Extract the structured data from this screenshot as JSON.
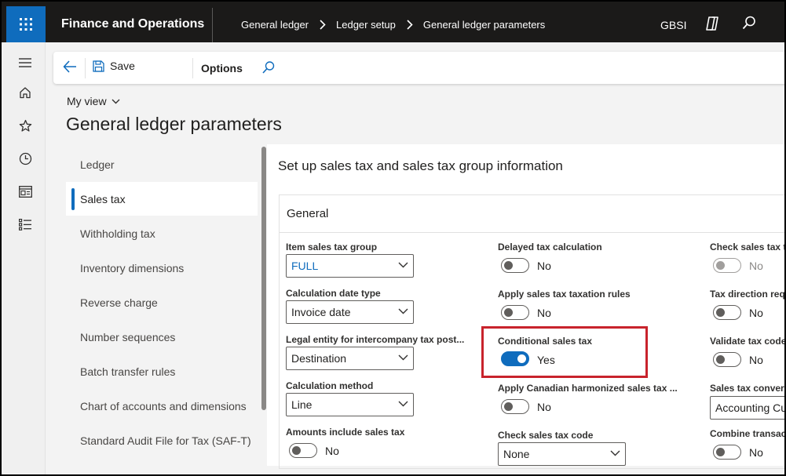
{
  "app": {
    "title": "Finance and Operations",
    "company": "GBSI"
  },
  "breadcrumbs": [
    "General ledger",
    "Ledger setup",
    "General ledger parameters"
  ],
  "action_pane": {
    "save_label": "Save",
    "options_label": "Options"
  },
  "page": {
    "view_label": "My view",
    "title": "General ledger parameters"
  },
  "nav": {
    "items": [
      {
        "label": "Ledger"
      },
      {
        "label": "Sales tax"
      },
      {
        "label": "Withholding tax"
      },
      {
        "label": "Inventory dimensions"
      },
      {
        "label": "Reverse charge"
      },
      {
        "label": "Number sequences"
      },
      {
        "label": "Batch transfer rules"
      },
      {
        "label": "Chart of accounts and dimensions"
      },
      {
        "label": "Standard Audit File for Tax (SAF-T)"
      }
    ],
    "active_index": 1
  },
  "detail": {
    "title": "Set up sales tax and sales tax group information",
    "section": "General",
    "col1": {
      "item_sales_tax_group": {
        "label": "Item sales tax group",
        "value": "FULL"
      },
      "calculation_date_type": {
        "label": "Calculation date type",
        "value": "Invoice date"
      },
      "legal_entity": {
        "label": "Legal entity for intercompany tax post...",
        "value": "Destination"
      },
      "calculation_method": {
        "label": "Calculation method",
        "value": "Line"
      },
      "amounts_include": {
        "label": "Amounts include sales tax",
        "value": "No"
      }
    },
    "col2": {
      "delayed": {
        "label": "Delayed tax calculation",
        "value": "No"
      },
      "apply_taxation_rules": {
        "label": "Apply sales tax taxation rules",
        "value": "No"
      },
      "conditional": {
        "label": "Conditional sales tax",
        "value": "Yes"
      },
      "canadian": {
        "label": "Apply Canadian harmonized sales tax ...",
        "value": "No"
      },
      "check_code": {
        "label": "Check sales tax code",
        "value": "None"
      }
    },
    "col3": {
      "check_trans": {
        "label": "Check sales tax tr",
        "value": "No"
      },
      "direction": {
        "label": "Tax direction requ",
        "value": "No"
      },
      "validate": {
        "label": "Validate tax code",
        "value": "No"
      },
      "conversion": {
        "label": "Sales tax conversi",
        "value": "Accounting Cu"
      },
      "combine": {
        "label": "Combine transact",
        "value": "No"
      }
    }
  },
  "colors": {
    "accent": "#0f6cbd",
    "topbar": "#1b1a19",
    "highlight": "#c8232c"
  }
}
